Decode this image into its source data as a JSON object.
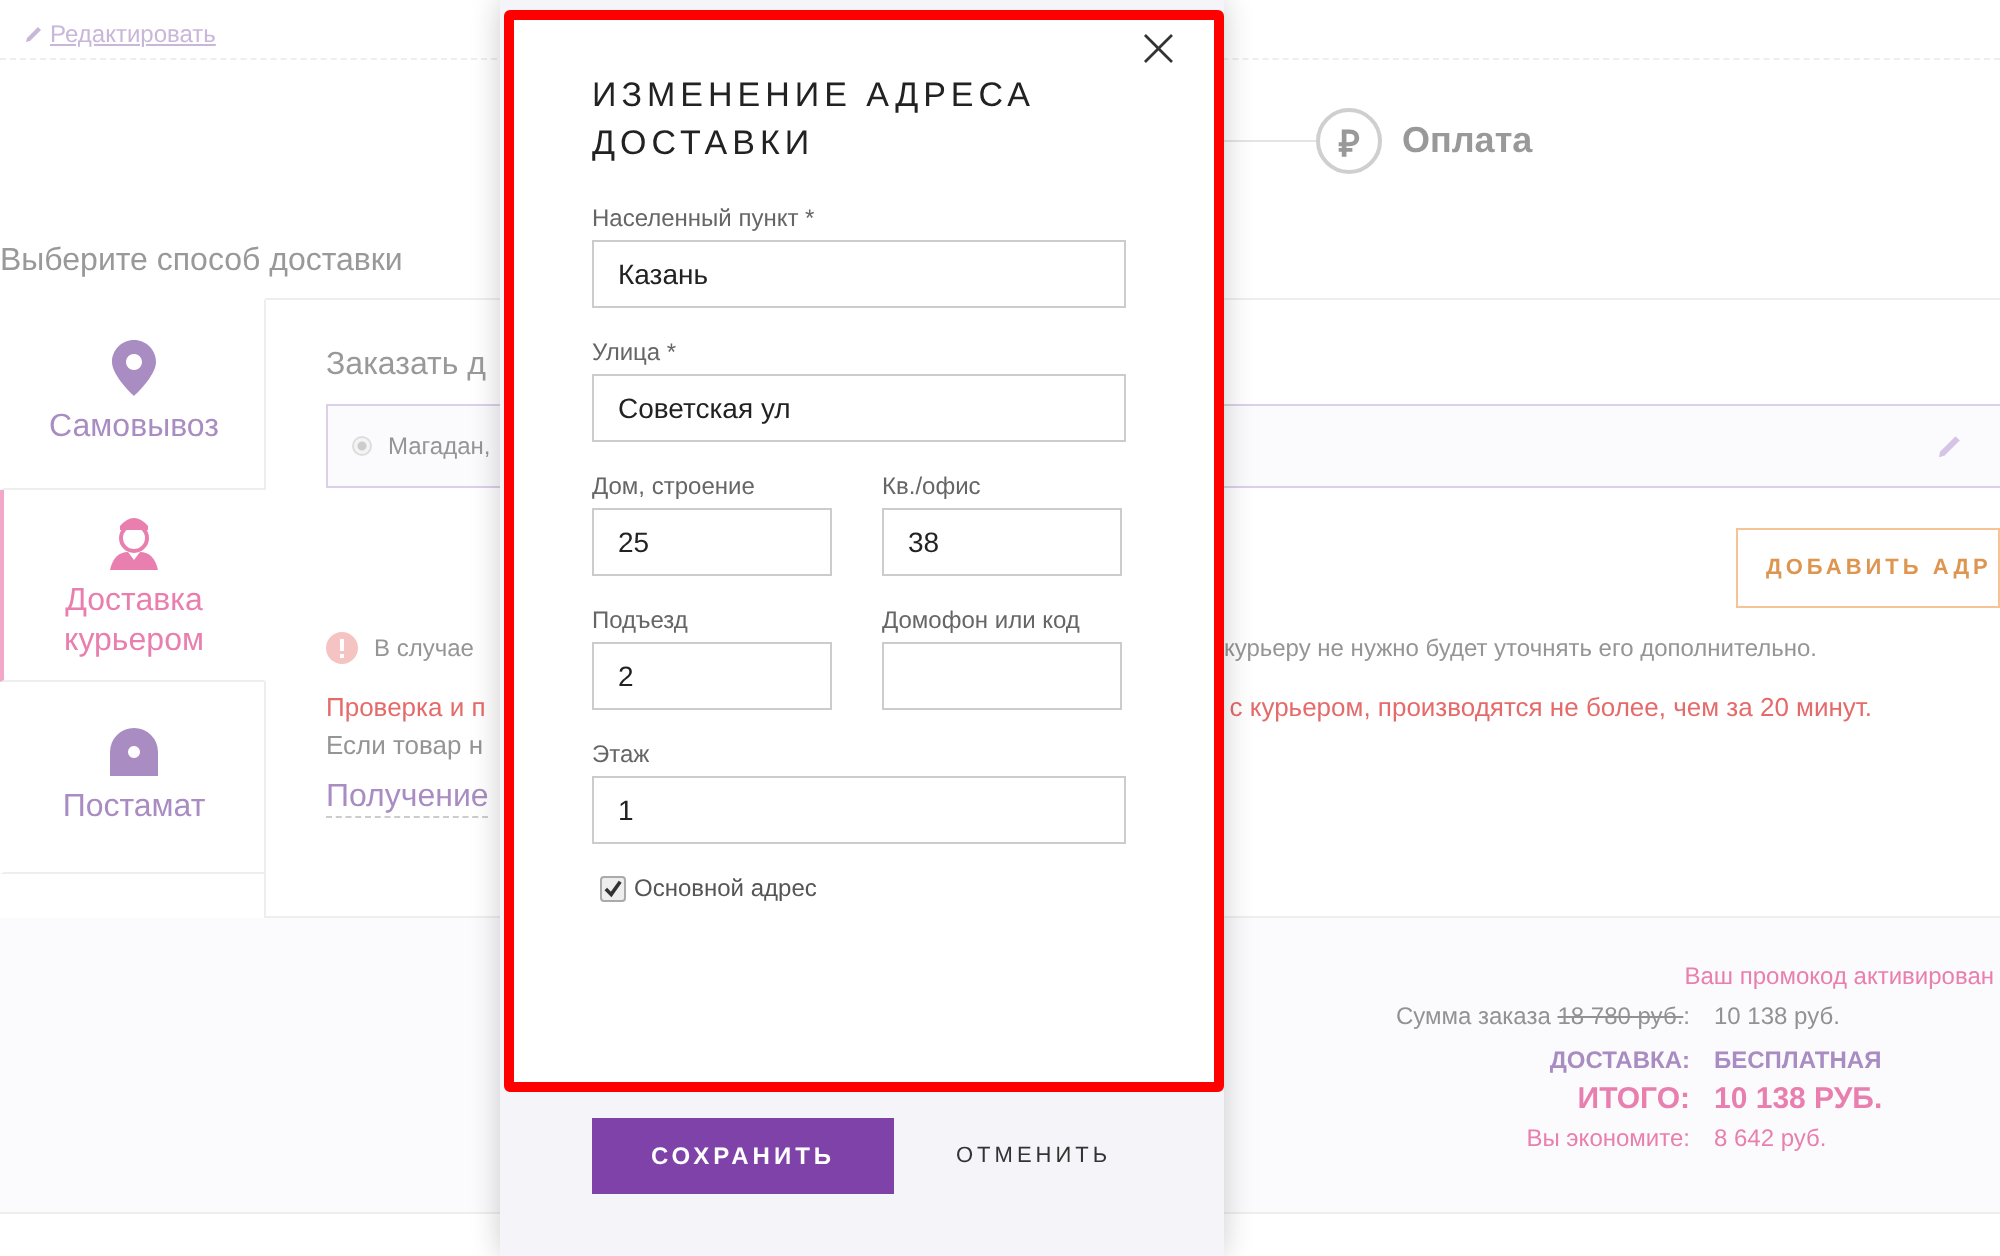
{
  "header": {
    "edit_link": "Редактировать"
  },
  "steps": [
    {
      "label": "Оплата",
      "icon": "₽"
    }
  ],
  "delivery": {
    "title": "Выберите способ доставки",
    "methods": [
      {
        "label": "Самовывоз",
        "selected": false
      },
      {
        "label": "Доставка курьером",
        "selected": true
      },
      {
        "label": "Постамат",
        "selected": false
      }
    ],
    "order_heading": "Заказать д",
    "addresses": [
      {
        "text": "Магадан,",
        "selected": true
      }
    ],
    "add_address_button": "ДОБАВИТЬ АДР",
    "notice": {
      "left": "В случае",
      "right": "курьеру не нужно будет уточнять его дополнительно."
    },
    "warning": {
      "left": "Проверка и п",
      "right": "с курьером, производятся не более, чем за 20 минут."
    },
    "info": "Если товар н",
    "receipt_link": "Получение"
  },
  "summary": {
    "promo": "Ваш промокод активирован",
    "rows": [
      {
        "kind": "subtotal",
        "label": "Сумма заказа",
        "old_value": "18 780 руб.",
        "separator": ":",
        "value": "10 138 руб."
      },
      {
        "kind": "delivery",
        "label": "ДОСТАВКА:",
        "value": "БЕСПЛАТНАЯ"
      },
      {
        "kind": "total",
        "label": "ИТОГО:",
        "value": "10 138 РУБ."
      },
      {
        "kind": "savings",
        "label": "Вы экономите:",
        "value": "8 642 руб."
      }
    ]
  },
  "modal": {
    "title": "ИЗМЕНЕНИЕ АДРЕСА ДОСТАВКИ",
    "close": "×",
    "rows": [
      [
        {
          "label": "Населенный пункт *",
          "value": "Казань"
        }
      ],
      [
        {
          "label": "Улица *",
          "value": "Советская ул"
        }
      ],
      [
        {
          "label": "Дом, строение",
          "value": "25"
        },
        {
          "label": "Кв./офис",
          "value": "38"
        }
      ],
      [
        {
          "label": "Подъезд",
          "value": "2"
        },
        {
          "label": "Домофон или код"
        }
      ],
      [
        {
          "label": "Этаж",
          "value": "1"
        }
      ]
    ],
    "primary_checkbox": {
      "label": "Основной адрес",
      "checked": true
    },
    "save_button": "СОХРАНИТЬ",
    "cancel_button": "ОТМЕНИТЬ"
  }
}
